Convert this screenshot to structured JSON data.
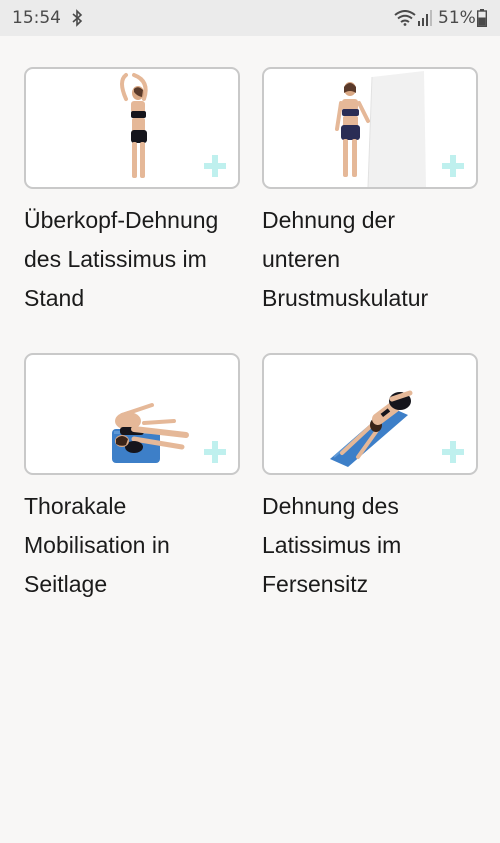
{
  "status_bar": {
    "time": "15:54",
    "battery": "51%"
  },
  "exercises": [
    {
      "title": "Überkopf-Dehnung des Latissimus im Stand",
      "image": "standing-overhead-stretch"
    },
    {
      "title": "Dehnung der unteren Brustmuskulatur",
      "image": "standing-wall-chest-stretch"
    },
    {
      "title": "Thorakale Mobilisation in Seitlage",
      "image": "side-lying-thoracic-rotation"
    },
    {
      "title": "Dehnung des Latissimus im Fersensitz",
      "image": "childs-pose-lat-stretch"
    }
  ],
  "colors": {
    "accent_plus": "#bff0ee",
    "mat": "#3d7fc8",
    "card_border": "#c9c9c9"
  }
}
